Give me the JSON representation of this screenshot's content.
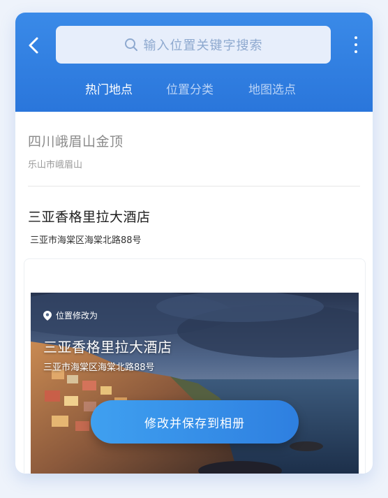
{
  "header": {
    "search_placeholder": "输入位置关键字搜索",
    "tabs": [
      {
        "label": "热门地点",
        "active": true
      },
      {
        "label": "位置分类",
        "active": false
      },
      {
        "label": "地图选点",
        "active": false
      }
    ]
  },
  "locations": [
    {
      "name": "四川峨眉山金顶",
      "address": "乐山市峨眉山",
      "muted": true
    },
    {
      "name": "三亚香格里拉大酒店",
      "address": "三亚市海棠区海棠北路88号",
      "muted": false
    }
  ],
  "preview": {
    "badge": "位置修改为",
    "title": "三亚香格里拉大酒店",
    "address": "三亚市海棠区海棠北路88号",
    "save_button": "修改并保存到相册"
  },
  "colors": {
    "header": "#2f7ee0",
    "button": "#3a93ec",
    "muted_text": "#8a8a8a",
    "primary_text": "#1e1e1e"
  },
  "icons": {
    "back": "chevron-left-icon",
    "search": "search-icon",
    "more": "more-vertical-icon",
    "pin": "location-pin-icon"
  }
}
